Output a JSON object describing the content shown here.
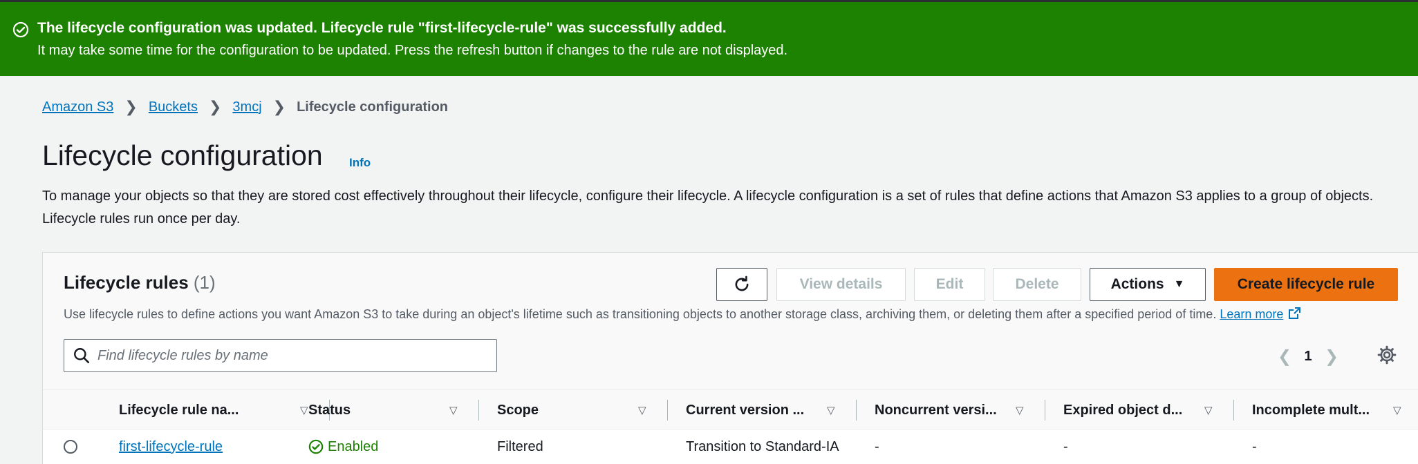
{
  "flash": {
    "title": "The lifecycle configuration was updated. Lifecycle rule \"first-lifecycle-rule\" was successfully added.",
    "message": "It may take some time for the configuration to be updated. Press the refresh button if changes to the rule are not displayed.",
    "color": "#1d8102",
    "icon": "success-check-icon"
  },
  "breadcrumb": {
    "items": [
      "Amazon S3",
      "Buckets",
      "3mcj"
    ],
    "current": "Lifecycle configuration"
  },
  "page": {
    "title": "Lifecycle configuration",
    "info": "Info",
    "description": "To manage your objects so that they are stored cost effectively throughout their lifecycle, configure their lifecycle. A lifecycle configuration is a set of rules that define actions that Amazon S3 applies to a group of objects. Lifecycle rules run once per day."
  },
  "rules_panel": {
    "title": "Lifecycle rules",
    "count": "(1)",
    "description": "Use lifecycle rules to define actions you want Amazon S3 to take during an object's lifetime such as transitioning objects to another storage class, archiving them, or deleting them after a specified period of time.",
    "learn_more": "Learn more",
    "buttons": {
      "view_details": "View details",
      "edit": "Edit",
      "delete": "Delete",
      "actions": "Actions",
      "create": "Create lifecycle rule"
    },
    "search_placeholder": "Find lifecycle rules by name",
    "page_number": "1",
    "columns": [
      "Lifecycle rule na...",
      "Status",
      "Scope",
      "Current version ...",
      "Noncurrent versi...",
      "Expired object d...",
      "Incomplete mult..."
    ],
    "rows": [
      {
        "name": "first-lifecycle-rule",
        "status": "Enabled",
        "scope": "Filtered",
        "current_version": "Transition to Standard-IA",
        "noncurrent": "-",
        "expired": "-",
        "incomplete": "-"
      }
    ],
    "accent_color": "#ec7211"
  }
}
